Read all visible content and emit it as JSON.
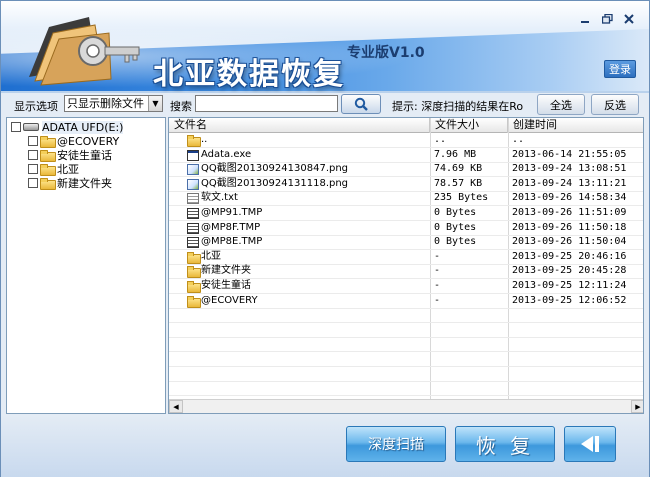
{
  "window": {
    "title": "北亚数据恢复",
    "edition": "专业版V1.0",
    "login_label": "登录",
    "controls": [
      "minimize",
      "maximize",
      "close"
    ]
  },
  "toolbar": {
    "display_option_label": "显示选项",
    "display_option_value": "只显示删除文件",
    "search_label": "搜索",
    "search_value": "",
    "hint": "提示: 深度扫描的结果在Ro",
    "select_all_label": "全选",
    "invert_label": "反选"
  },
  "tree": {
    "root": "ADATA UFD(E:)",
    "children": [
      "@ECOVERY",
      "安徒生童话",
      "北亚",
      "新建文件夹"
    ]
  },
  "list": {
    "columns": [
      "文件名",
      "文件大小",
      "创建时间"
    ],
    "rows": [
      {
        "icon": "folder-icon",
        "name": "..",
        "size": "..",
        "date": ".."
      },
      {
        "icon": "exe-icon",
        "name": "Adata.exe",
        "size": "7.96 MB",
        "date": "2013-06-14 21:55:05"
      },
      {
        "icon": "png-icon",
        "name": "QQ截图20130924130847.png",
        "size": "74.69 KB",
        "date": "2013-09-24 13:08:51"
      },
      {
        "icon": "png-icon",
        "name": "QQ截图20130924131118.png",
        "size": "78.57 KB",
        "date": "2013-09-24 13:11:21"
      },
      {
        "icon": "txt-icon",
        "name": "软文.txt",
        "size": "235 Bytes",
        "date": "2013-09-26 14:58:34"
      },
      {
        "icon": "tmp-icon",
        "name": "@MP91.TMP",
        "size": "0 Bytes",
        "date": "2013-09-26 11:51:09"
      },
      {
        "icon": "tmp-icon",
        "name": "@MP8F.TMP",
        "size": "0 Bytes",
        "date": "2013-09-26 11:50:18"
      },
      {
        "icon": "tmp-icon",
        "name": "@MP8E.TMP",
        "size": "0 Bytes",
        "date": "2013-09-26 11:50:04"
      },
      {
        "icon": "folder-icon",
        "name": "北亚",
        "size": "-",
        "date": "2013-09-25 20:46:16"
      },
      {
        "icon": "folder-icon",
        "name": "新建文件夹",
        "size": "-",
        "date": "2013-09-25 20:45:28"
      },
      {
        "icon": "folder-icon",
        "name": "安徒生童话",
        "size": "-",
        "date": "2013-09-25 12:11:24"
      },
      {
        "icon": "folder-icon",
        "name": "@ECOVERY",
        "size": "-",
        "date": "2013-09-25 12:06:52"
      }
    ]
  },
  "actions": {
    "deep_scan_label": "深度扫描",
    "recover_label": "恢 复",
    "back_icon": "back-arrow-icon"
  }
}
